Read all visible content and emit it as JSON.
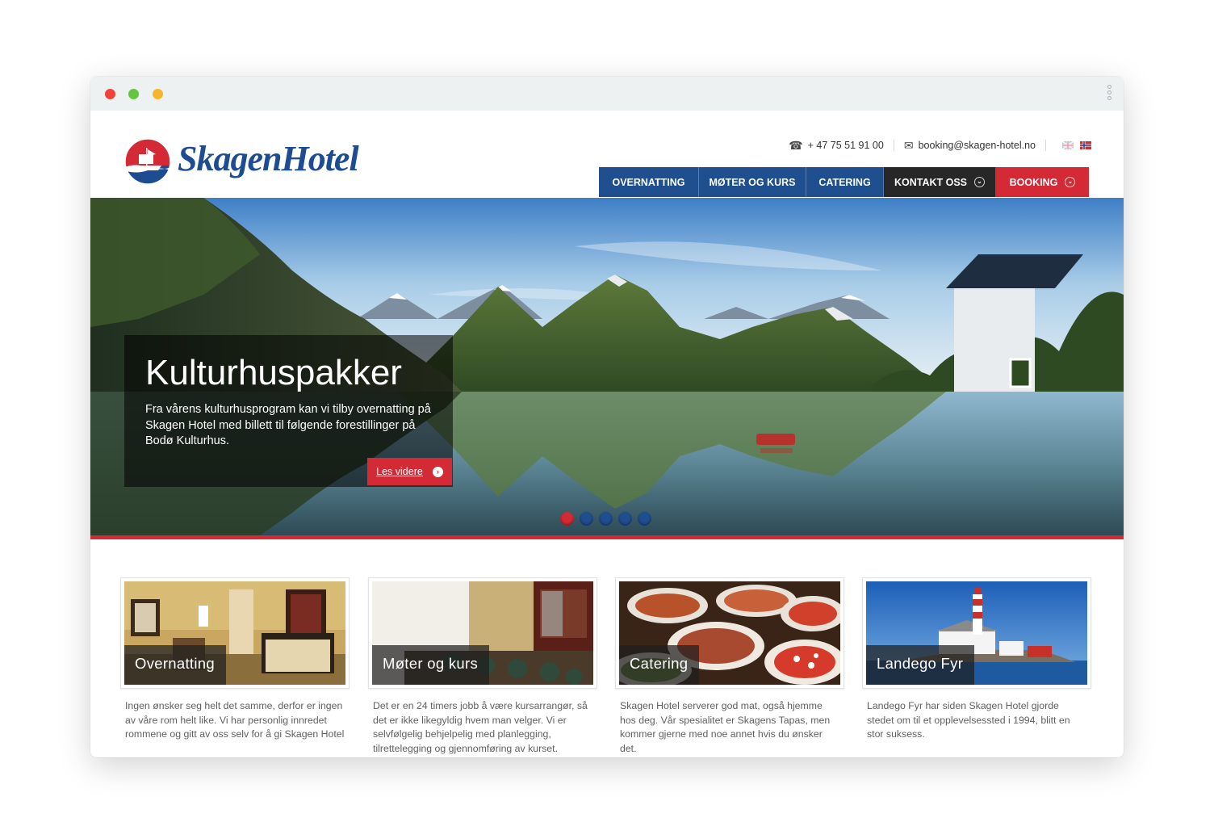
{
  "brand": {
    "name": "SkagenHotel"
  },
  "contact": {
    "phone": "+ 47 75 51 91 00",
    "email": "booking@skagen-hotel.no",
    "languages": [
      "English",
      "Norsk"
    ]
  },
  "nav": {
    "items": [
      {
        "label": "OVERNATTING"
      },
      {
        "label": "MØTER OG KURS"
      },
      {
        "label": "CATERING"
      },
      {
        "label": "KONTAKT OSS"
      },
      {
        "label": "BOOKING"
      }
    ]
  },
  "hero": {
    "title": "Kulturhuspakker",
    "text": "Fra vårens kulturhusprogram kan vi tilby overnatting på Skagen Hotel med billett til følgende forestillinger på Bodø Kulturhus.",
    "button_label": "Les videre",
    "slides": 5,
    "active_slide": 1
  },
  "cards": [
    {
      "label": "Overnatting",
      "text": "Ingen ønsker seg helt det samme, derfor er ingen av våre rom helt like.  Vi har personlig innredet rommene og gitt av oss selv for å gi Skagen Hotel"
    },
    {
      "label": "Møter og kurs",
      "text": "Det er en 24 timers jobb å være kursarrangør, så det er ikke likegyldig hvem man velger.  Vi er selvfølgelig behjelpelig med planlegging, tilrettelegging og gjennomføring av kurset."
    },
    {
      "label": "Catering",
      "text": "Skagen Hotel serverer god mat, også hjemme hos deg. Vår spesialitet er Skagens Tapas, men kommer gjerne med noe annet hvis du ønsker det."
    },
    {
      "label": "Landego Fyr",
      "text": "Landego Fyr har siden Skagen Hotel gjorde stedet om til et opplevelsessted i 1994, blitt en stor suksess."
    }
  ],
  "colors": {
    "blue": "#1f4f8f",
    "red": "#d42a36",
    "dark": "#272727"
  }
}
